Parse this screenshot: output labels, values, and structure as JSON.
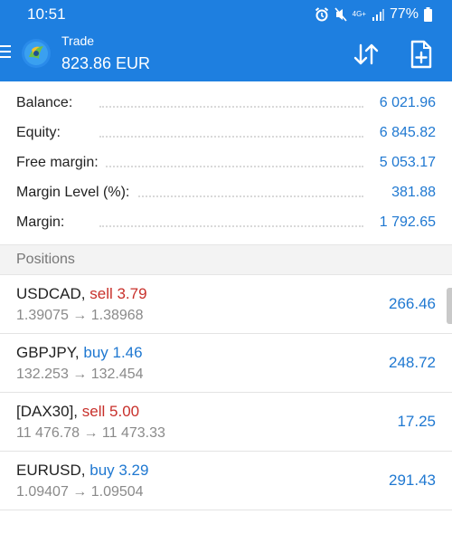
{
  "status_bar": {
    "time": "10:51",
    "network": "4G+",
    "battery_percent": "77%"
  },
  "app_bar": {
    "title": "Trade",
    "subtitle": "823.86 EUR",
    "menu_icon": "hamburger-menu-icon",
    "logo_icon": "metatrader-logo-icon",
    "sort_icon": "sort-arrows-icon",
    "new_order_icon": "new-order-icon"
  },
  "summary": [
    {
      "label": "Balance:",
      "value": "6 021.96"
    },
    {
      "label": "Equity:",
      "value": "6 845.82"
    },
    {
      "label": "Free margin:",
      "value": "5 053.17"
    },
    {
      "label": "Margin Level (%):",
      "value": "381.88"
    },
    {
      "label": "Margin:",
      "value": "1 792.65"
    }
  ],
  "positions_header": "Positions",
  "positions": [
    {
      "symbol": "USDCAD,",
      "side": "sell 3.79",
      "prices": "1.39075 → 1.38968",
      "profit": "266.46"
    },
    {
      "symbol": "GBPJPY,",
      "side": "buy 1.46",
      "prices": "132.253 → 132.454",
      "profit": "248.72"
    },
    {
      "symbol": "[DAX30],",
      "side": "sell 5.00",
      "prices": "11 476.78 → 11 473.33",
      "profit": "17.25"
    },
    {
      "symbol": "EURUSD,",
      "side": "buy 3.29",
      "prices": "1.09407 → 1.09504",
      "profit": "291.43"
    }
  ],
  "colors": {
    "accent": "#1e7fe0",
    "value_blue": "#1f78d1",
    "sell_red": "#c8302b",
    "secondary_text": "#8a8a8a"
  }
}
